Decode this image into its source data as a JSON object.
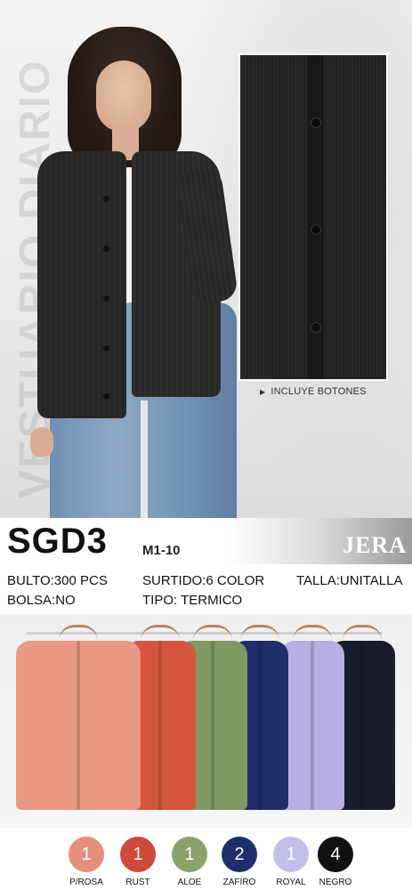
{
  "hero": {
    "side_text": "VESTUARIO DIARIO",
    "zoom_caption": "INCLUYE BOTONES"
  },
  "product": {
    "code": "SGD3",
    "model_range": "M1-10",
    "brand": "JERA",
    "bulto": "BULTO:300 PCS",
    "surtido": "SURTIDO:6 COLOR",
    "talla": "TALLA:UNITALLA",
    "bolsa": "BOLSA:NO",
    "tipo": "TIPO: TERMICO"
  },
  "colors": [
    {
      "count": "1",
      "label": "P/ROSA",
      "hex": "#e58f7c"
    },
    {
      "count": "1",
      "label": "RUST",
      "hex": "#cf4a3c"
    },
    {
      "count": "1",
      "label": "ALOE",
      "hex": "#8aa36c"
    },
    {
      "count": "2",
      "label": "ZAFIRO",
      "hex": "#1f2e6d"
    },
    {
      "count": "1",
      "label": "ROYAL",
      "hex": "#c3bfec"
    },
    {
      "count": "4",
      "label": "NEGRO",
      "hex": "#111111"
    }
  ],
  "garment_colors": [
    "#e99882",
    "#d5553f",
    "#7f9a62",
    "#222e6a",
    "#b7aee3",
    "#1a1d2a"
  ]
}
